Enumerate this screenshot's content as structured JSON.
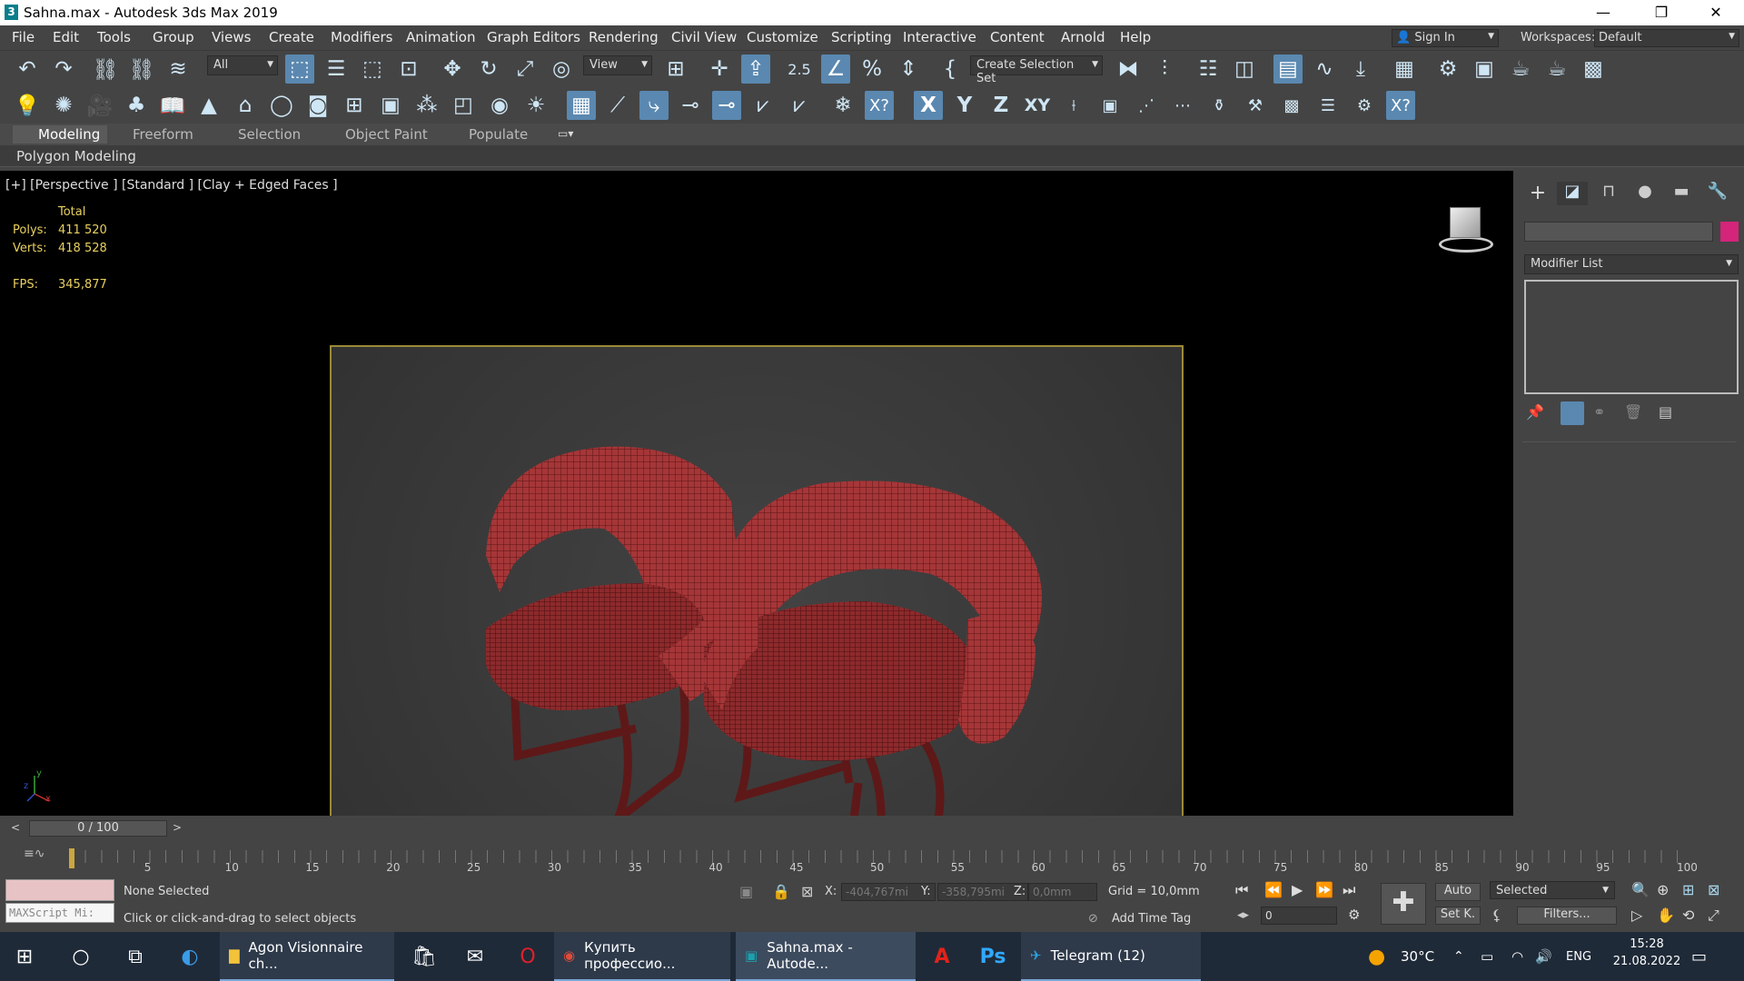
{
  "window": {
    "title": "Sahna.max - Autodesk 3ds Max 2019",
    "app_icon": "3"
  },
  "menu": [
    "File",
    "Edit",
    "Tools",
    "Group",
    "Views",
    "Create",
    "Modifiers",
    "Animation",
    "Graph Editors",
    "Rendering",
    "Civil View",
    "Customize",
    "Scripting",
    "Interactive",
    "Content",
    "Arnold",
    "Help"
  ],
  "signin": "Sign In",
  "workspaces_label": "Workspaces:",
  "workspace_value": "Default",
  "toolbar": {
    "filter": "All",
    "ref_coord": "View",
    "selection_set": "Create Selection Set",
    "snap_num": "2.5"
  },
  "ribbon_tabs": [
    "Modeling",
    "Freeform",
    "Selection",
    "Object Paint",
    "Populate"
  ],
  "polygon_modeling": "Polygon Modeling",
  "viewport": {
    "label": "[+] [Perspective ] [Standard ] [Clay + Edged Faces ]",
    "stats_header": "Total",
    "polys_label": "Polys:",
    "polys": "411 520",
    "verts_label": "Verts:",
    "verts": "418 528",
    "fps_label": "FPS:",
    "fps": "345,877",
    "axis_y": "y",
    "axis_z": "z",
    "axis_x": "x"
  },
  "command_panel": {
    "modifier_list": "Modifier List",
    "color_swatch": "#d4257a"
  },
  "time": {
    "frame": "0 / 100",
    "ticks": [
      "5",
      "10",
      "15",
      "20",
      "25",
      "30",
      "35",
      "40",
      "45",
      "50",
      "55",
      "60",
      "65",
      "70",
      "75",
      "80",
      "85",
      "90",
      "95",
      "100"
    ]
  },
  "status": {
    "selection": "None Selected",
    "prompt": "Click or click-and-drag to select objects",
    "maxscript": "MAXScript Mi:",
    "x_label": "X:",
    "x": "-404,767mi",
    "y_label": "Y:",
    "y": "-358,795mi",
    "z_label": "Z:",
    "z": "0,0mm",
    "grid": "Grid = 10,0mm",
    "add_time_tag": "Add Time Tag",
    "auto": "Auto",
    "selected": "Selected",
    "setk": "Set K.",
    "filters": "Filters...",
    "frame_field": "0"
  },
  "taskbar": {
    "apps": [
      "Agon Visionnaire ch...",
      "Купить профессио...",
      "Sahna.max - Autode...",
      "Telegram (12)"
    ],
    "temp": "30°C",
    "lang": "ENG",
    "time": "15:28",
    "date": "21.08.2022"
  }
}
